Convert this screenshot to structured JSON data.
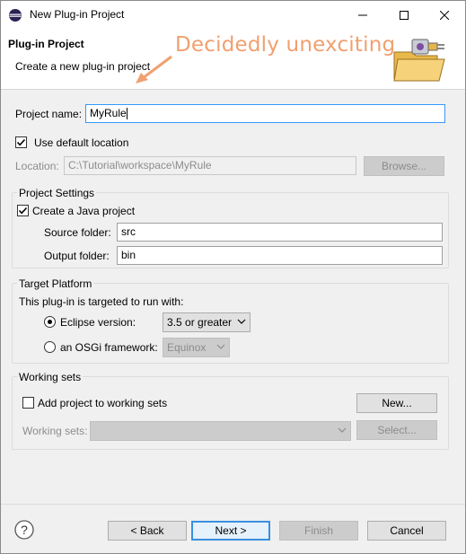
{
  "window": {
    "title": "New Plug-in Project",
    "minimize_glyph": "—",
    "maximize_glyph": "☐",
    "close_glyph": "✕"
  },
  "banner": {
    "title": "Plug-in Project",
    "description": "Create a new plug-in project",
    "annotation": "Decidedly unexciting"
  },
  "project": {
    "name_label": "Project name:",
    "name_value": "MyRule",
    "use_default_label": "Use default location",
    "use_default_checked": true,
    "location_label": "Location:",
    "location_value": "C:\\Tutorial\\workspace\\MyRule",
    "browse_label": "Browse..."
  },
  "project_settings": {
    "title": "Project Settings",
    "create_java_label": "Create a Java project",
    "create_java_checked": true,
    "source_label": "Source folder:",
    "source_value": "src",
    "output_label": "Output folder:",
    "output_value": "bin"
  },
  "target_platform": {
    "title": "Target Platform",
    "intro": "This plug-in is targeted to run with:",
    "eclipse_label": "Eclipse version:",
    "eclipse_selected": true,
    "eclipse_value": "3.5 or greater",
    "osgi_label": "an OSGi framework:",
    "osgi_value": "Equinox"
  },
  "working_sets": {
    "title": "Working sets",
    "add_label": "Add project to working sets",
    "add_checked": false,
    "new_label": "New...",
    "sets_label": "Working sets:",
    "sets_value": "",
    "select_label": "Select..."
  },
  "footer": {
    "help_glyph": "?",
    "back_label": "< Back",
    "next_label": "Next >",
    "finish_label": "Finish",
    "cancel_label": "Cancel"
  },
  "colors": {
    "accent": "#3399ff",
    "annotation": "#f0a070"
  }
}
